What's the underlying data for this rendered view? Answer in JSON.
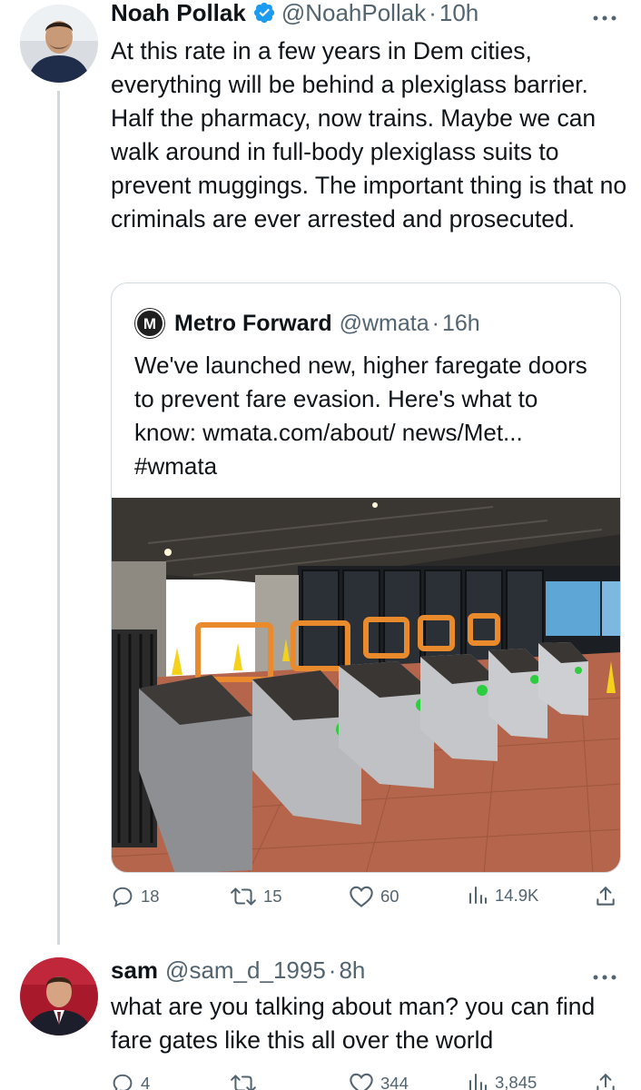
{
  "tweet": {
    "author_name": "Noah Pollak",
    "handle": "@NoahPollak",
    "time": "10h",
    "text": "At this rate in a few years in Dem cities, everything will be behind a plexiglass barrier. Half the pharmacy, now trains. Maybe we can walk around in full-body plexiglass suits to prevent muggings. The important thing is that no criminals are ever arrested and prosecuted.",
    "more_icon": "more-dots-icon",
    "quote": {
      "author_name": "Metro Forward",
      "handle": "@wmata",
      "time": "16h",
      "avatar_letter": "M",
      "text": "We've launched new, higher faregate doors to prevent fare evasion. Here's what to know: wmata.com/about/ news/Met... #wmata"
    },
    "stats": {
      "replies": "18",
      "retweets": "15",
      "likes": "60",
      "views": "14.9K"
    }
  },
  "reply": {
    "author_name": "sam",
    "handle": "@sam_d_1995",
    "time": "8h",
    "text": "what are you talking about man? you can find fare gates like this all over the world",
    "stats": {
      "replies": "4",
      "likes": "344",
      "views": "3,845"
    }
  },
  "colors": {
    "verified": "#1d9bf0",
    "secondary_text": "#536471",
    "border": "#cfd9de"
  }
}
